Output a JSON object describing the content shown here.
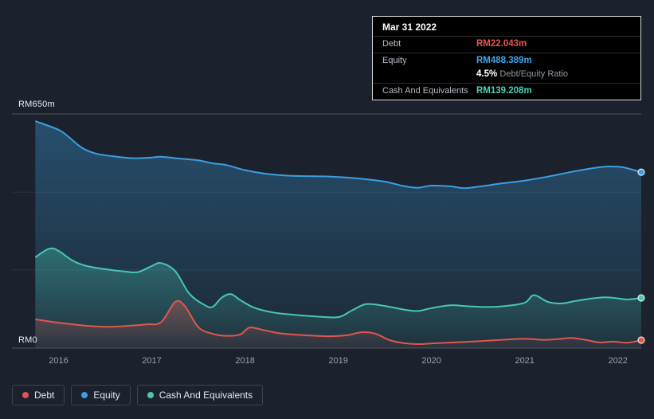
{
  "colors": {
    "background": "#1b222d"
  },
  "tooltip": {
    "date": "Mar 31 2022",
    "rows": [
      {
        "label": "Debt",
        "value": "RM22.043m",
        "color": "#e8554d"
      },
      {
        "label": "Equity",
        "value": "RM488.389m",
        "color": "#41a6ea"
      },
      {
        "label": "",
        "ratio_bold": "4.5%",
        "ratio_text": "Debt/Equity Ratio"
      },
      {
        "label": "Cash And Equivalents",
        "value": "RM139.208m",
        "color": "#4ad0b8"
      }
    ]
  },
  "legend": [
    {
      "label": "Debt",
      "color": "#e2554f"
    },
    {
      "label": "Equity",
      "color": "#3b9fe0"
    },
    {
      "label": "Cash And Equivalents",
      "color": "#46c8b2"
    }
  ],
  "chart_data": {
    "type": "area",
    "title": "",
    "ylabel": "",
    "xlabel": "",
    "ylim": [
      0,
      650
    ],
    "xlim": [
      2015.5,
      2022.25
    ],
    "y_axis_labels": {
      "top": "RM650m",
      "bottom": "RM0"
    },
    "y_gridlines": [
      650,
      433,
      217,
      0
    ],
    "x_ticks": [
      "2016",
      "2017",
      "2018",
      "2019",
      "2020",
      "2021",
      "2022"
    ],
    "legend_position": "bottom-left",
    "series": [
      {
        "key": "equity",
        "name": "Equity",
        "color": "#3b9fe0",
        "x": [
          2015.75,
          2016.0,
          2016.1,
          2016.25,
          2016.4,
          2016.6,
          2016.8,
          2017.0,
          2017.1,
          2017.3,
          2017.5,
          2017.65,
          2017.8,
          2018.0,
          2018.25,
          2018.5,
          2018.75,
          2019.0,
          2019.25,
          2019.5,
          2019.7,
          2019.85,
          2020.0,
          2020.2,
          2020.35,
          2020.5,
          2020.75,
          2021.0,
          2021.25,
          2021.5,
          2021.75,
          2021.9,
          2022.05,
          2022.25
        ],
        "values": [
          630,
          606,
          588,
          556,
          540,
          532,
          527,
          529,
          531,
          526,
          521,
          513,
          508,
          494,
          483,
          478,
          477,
          475,
          470,
          462,
          450,
          445,
          451,
          449,
          444,
          448,
          457,
          465,
          476,
          489,
          500,
          504,
          502,
          488.389
        ]
      },
      {
        "key": "cash-and-equivalents",
        "name": "Cash And Equivalents",
        "color": "#46c8b2",
        "x": [
          2015.75,
          2015.9,
          2016.0,
          2016.15,
          2016.3,
          2016.5,
          2016.7,
          2016.85,
          2017.0,
          2017.1,
          2017.25,
          2017.4,
          2017.55,
          2017.65,
          2017.75,
          2017.85,
          2017.95,
          2018.1,
          2018.3,
          2018.5,
          2018.75,
          2019.0,
          2019.15,
          2019.3,
          2019.5,
          2019.7,
          2019.85,
          2020.0,
          2020.2,
          2020.4,
          2020.6,
          2020.8,
          2021.0,
          2021.1,
          2021.25,
          2021.4,
          2021.55,
          2021.7,
          2021.85,
          2022.0,
          2022.1,
          2022.25
        ],
        "values": [
          252,
          276,
          270,
          243,
          228,
          219,
          213,
          211,
          228,
          236,
          214,
          152,
          122,
          114,
          140,
          150,
          133,
          112,
          99,
          93,
          88,
          86,
          105,
          122,
          117,
          107,
          103,
          111,
          119,
          116,
          114,
          117,
          126,
          147,
          128,
          124,
          131,
          137,
          141,
          138,
          135,
          139.208
        ]
      },
      {
        "key": "debt",
        "name": "Debt",
        "color": "#e2554f",
        "x": [
          2015.75,
          2015.95,
          2016.15,
          2016.35,
          2016.55,
          2016.75,
          2016.95,
          2017.1,
          2017.25,
          2017.35,
          2017.5,
          2017.65,
          2017.8,
          2017.95,
          2018.05,
          2018.2,
          2018.35,
          2018.5,
          2018.7,
          2018.9,
          2019.1,
          2019.25,
          2019.4,
          2019.55,
          2019.7,
          2019.85,
          2020.0,
          2020.25,
          2020.5,
          2020.75,
          2021.0,
          2021.2,
          2021.35,
          2021.5,
          2021.65,
          2021.8,
          2021.95,
          2022.1,
          2022.25
        ],
        "values": [
          80,
          72,
          66,
          61,
          59,
          62,
          66,
          72,
          128,
          118,
          58,
          40,
          34,
          38,
          57,
          50,
          42,
          38,
          35,
          33,
          36,
          44,
          40,
          22,
          14,
          11,
          13,
          16,
          19,
          23,
          26,
          23,
          25,
          28,
          23,
          16,
          18,
          15,
          22.043
        ]
      }
    ]
  }
}
